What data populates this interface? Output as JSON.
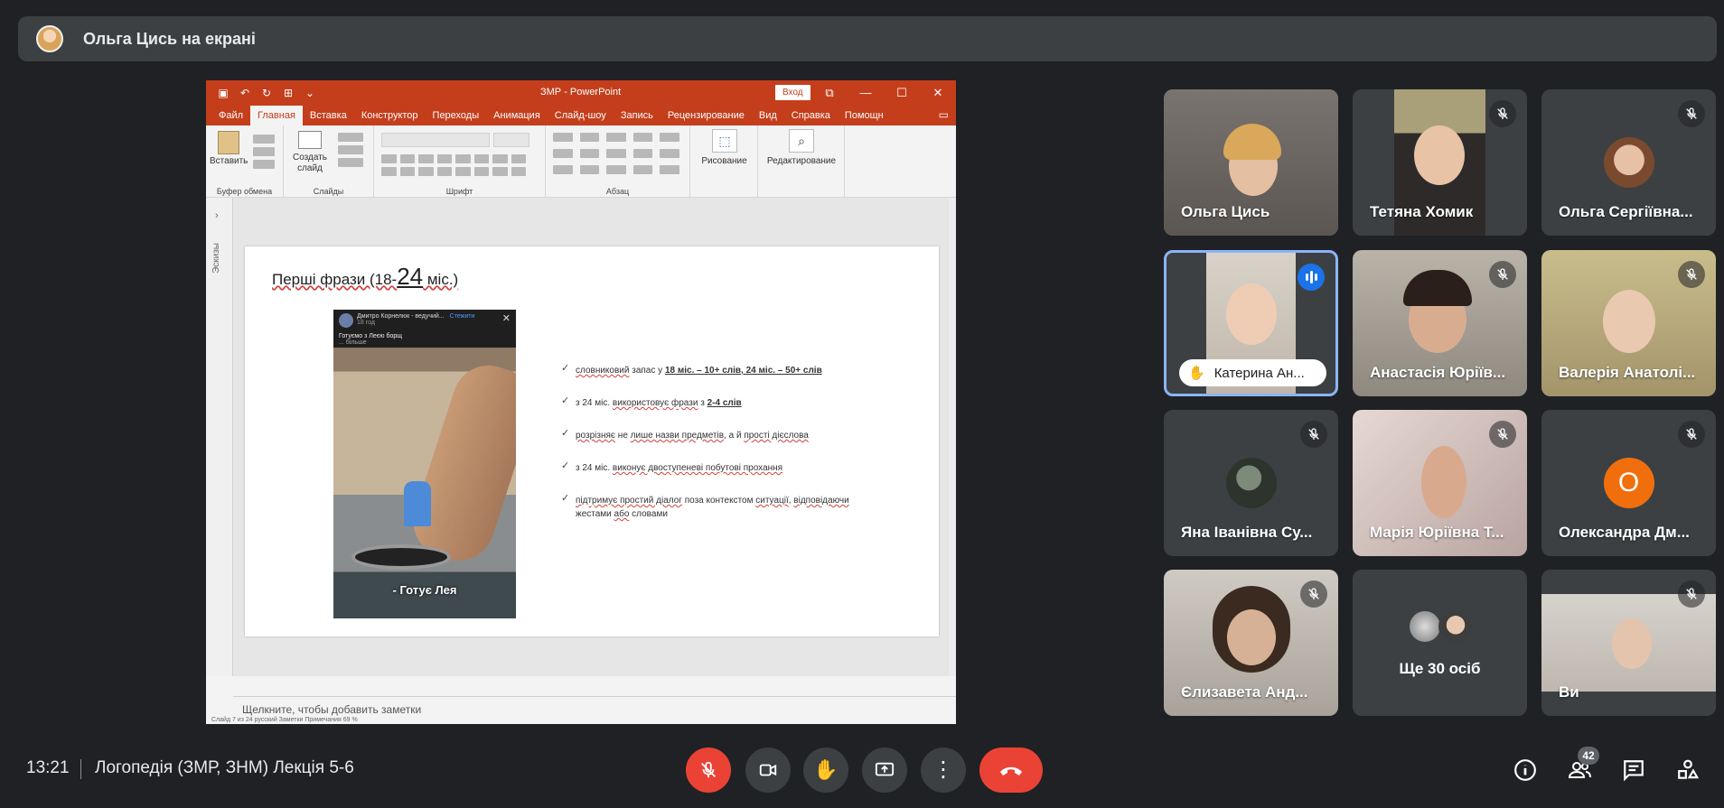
{
  "presenter": {
    "text": "Ольга Цись на екрані"
  },
  "powerpoint": {
    "doc_title": "ЗМР - PowerPoint",
    "login": "Вход",
    "menu": [
      "Файл",
      "Главная",
      "Вставка",
      "Конструктор",
      "Переходы",
      "Анимация",
      "Слайд-шоу",
      "Запись",
      "Рецензирование",
      "Вид",
      "Справка",
      "Помощн"
    ],
    "ribbon": {
      "paste": "Вставить",
      "new_slide": "Создать слайд",
      "drawing": "Рисование",
      "editing": "Редактирование",
      "groups": [
        "Буфер обмена",
        "Слайды",
        "Шрифт",
        "Абзац"
      ]
    },
    "thumbs_label": "Эскизы",
    "notes_placeholder": "Щелкните, чтобы добавить заметки",
    "status": "Слайд 7 из 24   русский                                  Заметки   Примечания                       69 %",
    "slide": {
      "title_prefix": "Перші фрази (18-",
      "title_big": "24",
      "title_suffix": " міс.)",
      "video": {
        "author": "Дмитро Корнелюк - ведучий...",
        "follow": "Стежити",
        "time": "18 год",
        "caption": "Готуємо з Леєю борщ",
        "more": "... більше",
        "subtitle": "- Готує Лея"
      },
      "bullets": [
        [
          "словниковий",
          " запас у ",
          "18 міс. – 10+ слів, 24 міс. – 50+ слів"
        ],
        [
          "з 24 міс. ",
          "використовує фрази",
          " з ",
          "2-4 слів"
        ],
        [
          "розрізняє",
          " не ",
          "лише назви предметів",
          ", а й ",
          "прості дієслова"
        ],
        [
          "з 24 міс. ",
          "виконує двоступеневі побутові прохання"
        ],
        [
          "підтримує простий діалог",
          " поза контекстом ",
          "ситуації",
          ", ",
          "відповідаючи",
          " жестами ",
          "або",
          " словами"
        ]
      ]
    }
  },
  "participants": [
    {
      "name": "Ольга Цись",
      "muted": false
    },
    {
      "name": "Тетяна Хомик",
      "muted": true
    },
    {
      "name": "Ольга Сергіївна...",
      "muted": true
    },
    {
      "name": "Катерина Ан...",
      "muted": false,
      "speaking": true,
      "hand_raised": true
    },
    {
      "name": "Анастасія Юріїв...",
      "muted": true
    },
    {
      "name": "Валерія Анатолі...",
      "muted": true
    },
    {
      "name": "Яна Іванівна Су...",
      "muted": true
    },
    {
      "name": "Марія Юріївна Т...",
      "muted": true
    },
    {
      "name": "Олександра Дм...",
      "muted": true,
      "initial": "О",
      "avatar_color": "#f06f0c"
    },
    {
      "name": "Єлизавета Анд...",
      "muted": true
    },
    {
      "more_label": "Ще 30 осіб"
    },
    {
      "name": "Ви",
      "muted": true
    }
  ],
  "bottom": {
    "time": "13:21",
    "meeting_name": "Логопедія (ЗМР, ЗНМ) Лекція 5-6",
    "people_count": "42"
  },
  "colors": {
    "end_call": "#ea4335",
    "speaking": "#1a73e8",
    "ppt_accent": "#c43e1c"
  }
}
